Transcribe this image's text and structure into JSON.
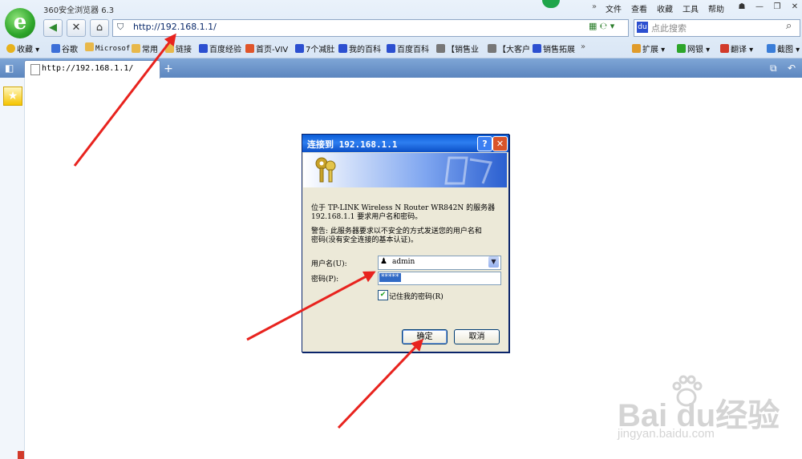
{
  "app": {
    "title": "360安全浏览器 6.3",
    "menu": [
      "文件",
      "查看",
      "收藏",
      "工具",
      "帮助"
    ]
  },
  "address_bar": {
    "url": "http://192.168.1.1/"
  },
  "search": {
    "placeholder": "点此搜索"
  },
  "bookmarks": [
    {
      "label": "收藏",
      "color": "#e7b21c"
    },
    {
      "label": "谷歌",
      "color": "#3c6fd8"
    },
    {
      "label": "Microsof",
      "color": "#e8b84a"
    },
    {
      "label": "常用",
      "color": "#e8b84a"
    },
    {
      "label": "链接",
      "color": "#e8b84a"
    },
    {
      "label": "百度经验",
      "color": "#2c4fd0"
    },
    {
      "label": "首页-VIV",
      "color": "#e0552a"
    },
    {
      "label": "7个减肚",
      "color": "#2c4fd0"
    },
    {
      "label": "我的百科",
      "color": "#2c4fd0"
    },
    {
      "label": "百度百科",
      "color": "#2c4fd0"
    },
    {
      "label": "【销售业",
      "color": "#777777"
    },
    {
      "label": "【大客户",
      "color": "#777777"
    },
    {
      "label": "销售拓展",
      "color": "#2c4fd0"
    }
  ],
  "toolbar_right": [
    "扩展",
    "网银",
    "翻译",
    "截图"
  ],
  "tab": {
    "label": "http://192.168.1.1/"
  },
  "dialog": {
    "title": "连接到 192.168.1.1",
    "message_line1": "位于 TP-LINK Wireless N Router WR842N 的服务器",
    "message_line2": "192.168.1.1 要求用户名和密码。",
    "warning_line1": "警告: 此服务器要求以不安全的方式发送您的用户名和",
    "warning_line2": "密码(没有安全连接的基本认证)。",
    "username_label": "用户名(U):",
    "username_value": "admin",
    "password_label": "密码(P):",
    "password_value": "*****",
    "remember_label": "记住我的密码(R)",
    "ok_label": "确定",
    "cancel_label": "取消"
  },
  "watermark": {
    "brand": "Bai  du经验",
    "url": "jingyan.baidu.com"
  }
}
